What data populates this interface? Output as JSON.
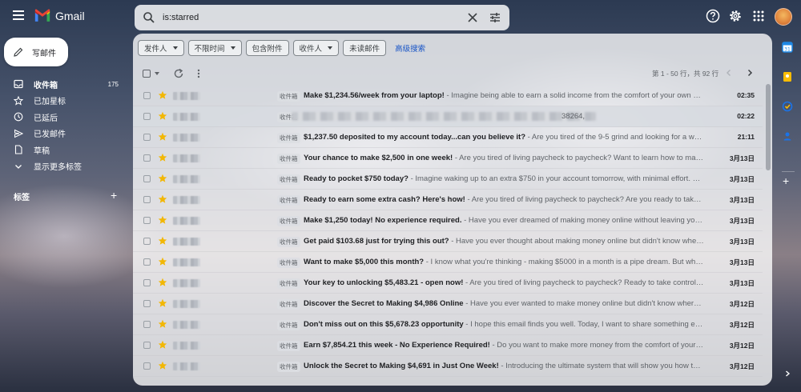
{
  "app": {
    "name": "Gmail"
  },
  "search": {
    "value": "is:starred"
  },
  "compose": {
    "label": "写邮件"
  },
  "nav": {
    "items": [
      {
        "label": "收件箱",
        "count": "175",
        "icon": "inbox-icon",
        "active": true
      },
      {
        "label": "已加星标",
        "count": "",
        "icon": "star-outline-icon"
      },
      {
        "label": "已延后",
        "count": "",
        "icon": "clock-icon"
      },
      {
        "label": "已发邮件",
        "count": "",
        "icon": "send-icon"
      },
      {
        "label": "草稿",
        "count": "",
        "icon": "draft-icon"
      },
      {
        "label": "显示更多标签",
        "count": "",
        "icon": "chevron-down-icon"
      }
    ],
    "labels_heading": "标签"
  },
  "filters": {
    "chips": [
      {
        "label": "发件人",
        "dropdown": true
      },
      {
        "label": "不限时间",
        "dropdown": true
      },
      {
        "label": "包含附件",
        "dropdown": false
      },
      {
        "label": "收件人",
        "dropdown": true
      },
      {
        "label": "未读邮件",
        "dropdown": false
      }
    ],
    "advanced": "高级搜索"
  },
  "pager": {
    "text": "第 1 - 50 行，共 92 行"
  },
  "emails": [
    {
      "tag": "收件箱",
      "subject": "Make $1,234.56/week from your laptop!",
      "snippet": " - Imagine being able to earn a solid income from the comfort of your own ho...",
      "date": "02:35",
      "starred": true
    },
    {
      "tag": "收件箱",
      "subject": "",
      "snippet": "38264,",
      "date": "02:22",
      "starred": true,
      "blurred": true
    },
    {
      "tag": "收件箱",
      "subject": "$1,237.50 deposited to my account today...can you believe it?",
      "snippet": " - Are you tired of the 9-5 grind and looking for a way ...",
      "date": "21:11",
      "starred": true,
      "partial": true
    },
    {
      "tag": "收件箱",
      "subject": "Your chance to make $2,500 in one week!",
      "snippet": " - Are you tired of living paycheck to paycheck? Want to learn how to make ...",
      "date": "3月13日",
      "starred": true
    },
    {
      "tag": "收件箱",
      "subject": "Ready to pocket $750 today?",
      "snippet": " - Imagine waking up to an extra $750 in your account tomorrow, with minimal effort. So...",
      "date": "3月13日",
      "starred": true
    },
    {
      "tag": "收件箱",
      "subject": "Ready to earn some extra cash? Here's how!",
      "snippet": " - Are you tired of living paycheck to paycheck? Are you ready to take co...",
      "date": "3月13日",
      "starred": true
    },
    {
      "tag": "收件箱",
      "subject": "Make $1,250 today! No experience required.",
      "snippet": " - Have you ever dreamed of making money online without leaving your h...",
      "date": "3月13日",
      "starred": true
    },
    {
      "tag": "收件箱",
      "subject": "Get paid $103.68 just for trying this out?",
      "snippet": " - Have you ever thought about making money online but didn't know where ...",
      "date": "3月13日",
      "starred": true
    },
    {
      "tag": "收件箱",
      "subject": "Want to make $5,000 this month?",
      "snippet": " - I know what you're thinking - making $5000 in a month is a pipe dream. But what...",
      "date": "3月13日",
      "starred": true
    },
    {
      "tag": "收件箱",
      "subject": "Your key to unlocking $5,483.21 - open now!",
      "snippet": " - Are you tired of living paycheck to paycheck? Ready to take control of ...",
      "date": "3月13日",
      "starred": true
    },
    {
      "tag": "收件箱",
      "subject": "Discover the Secret to Making $4,986 Online",
      "snippet": " - Have you ever wanted to make money online but didn't know where to...",
      "date": "3月12日",
      "starred": true
    },
    {
      "tag": "收件箱",
      "subject": "Don't miss out on this $5,678.23 opportunity",
      "snippet": " - I hope this email finds you well. Today, I want to share something exciti...",
      "date": "3月12日",
      "starred": true
    },
    {
      "tag": "收件箱",
      "subject": "Earn $7,854.21 this week - No Experience Required!",
      "snippet": " - Do you want to make more money from the comfort of your ow...",
      "date": "3月12日",
      "starred": true
    },
    {
      "tag": "收件箱",
      "subject": "Unlock the Secret to Making $4,691 in Just One Week!",
      "snippet": " - Introducing the ultimate system that will show you how to make ...",
      "date": "3月12日",
      "starred": true
    }
  ],
  "colors": {
    "star": "#f2b705",
    "link": "#1a56c7",
    "calendar": "#1e88e5",
    "keep": "#fbbc04",
    "tasks": "#1a73e8"
  }
}
